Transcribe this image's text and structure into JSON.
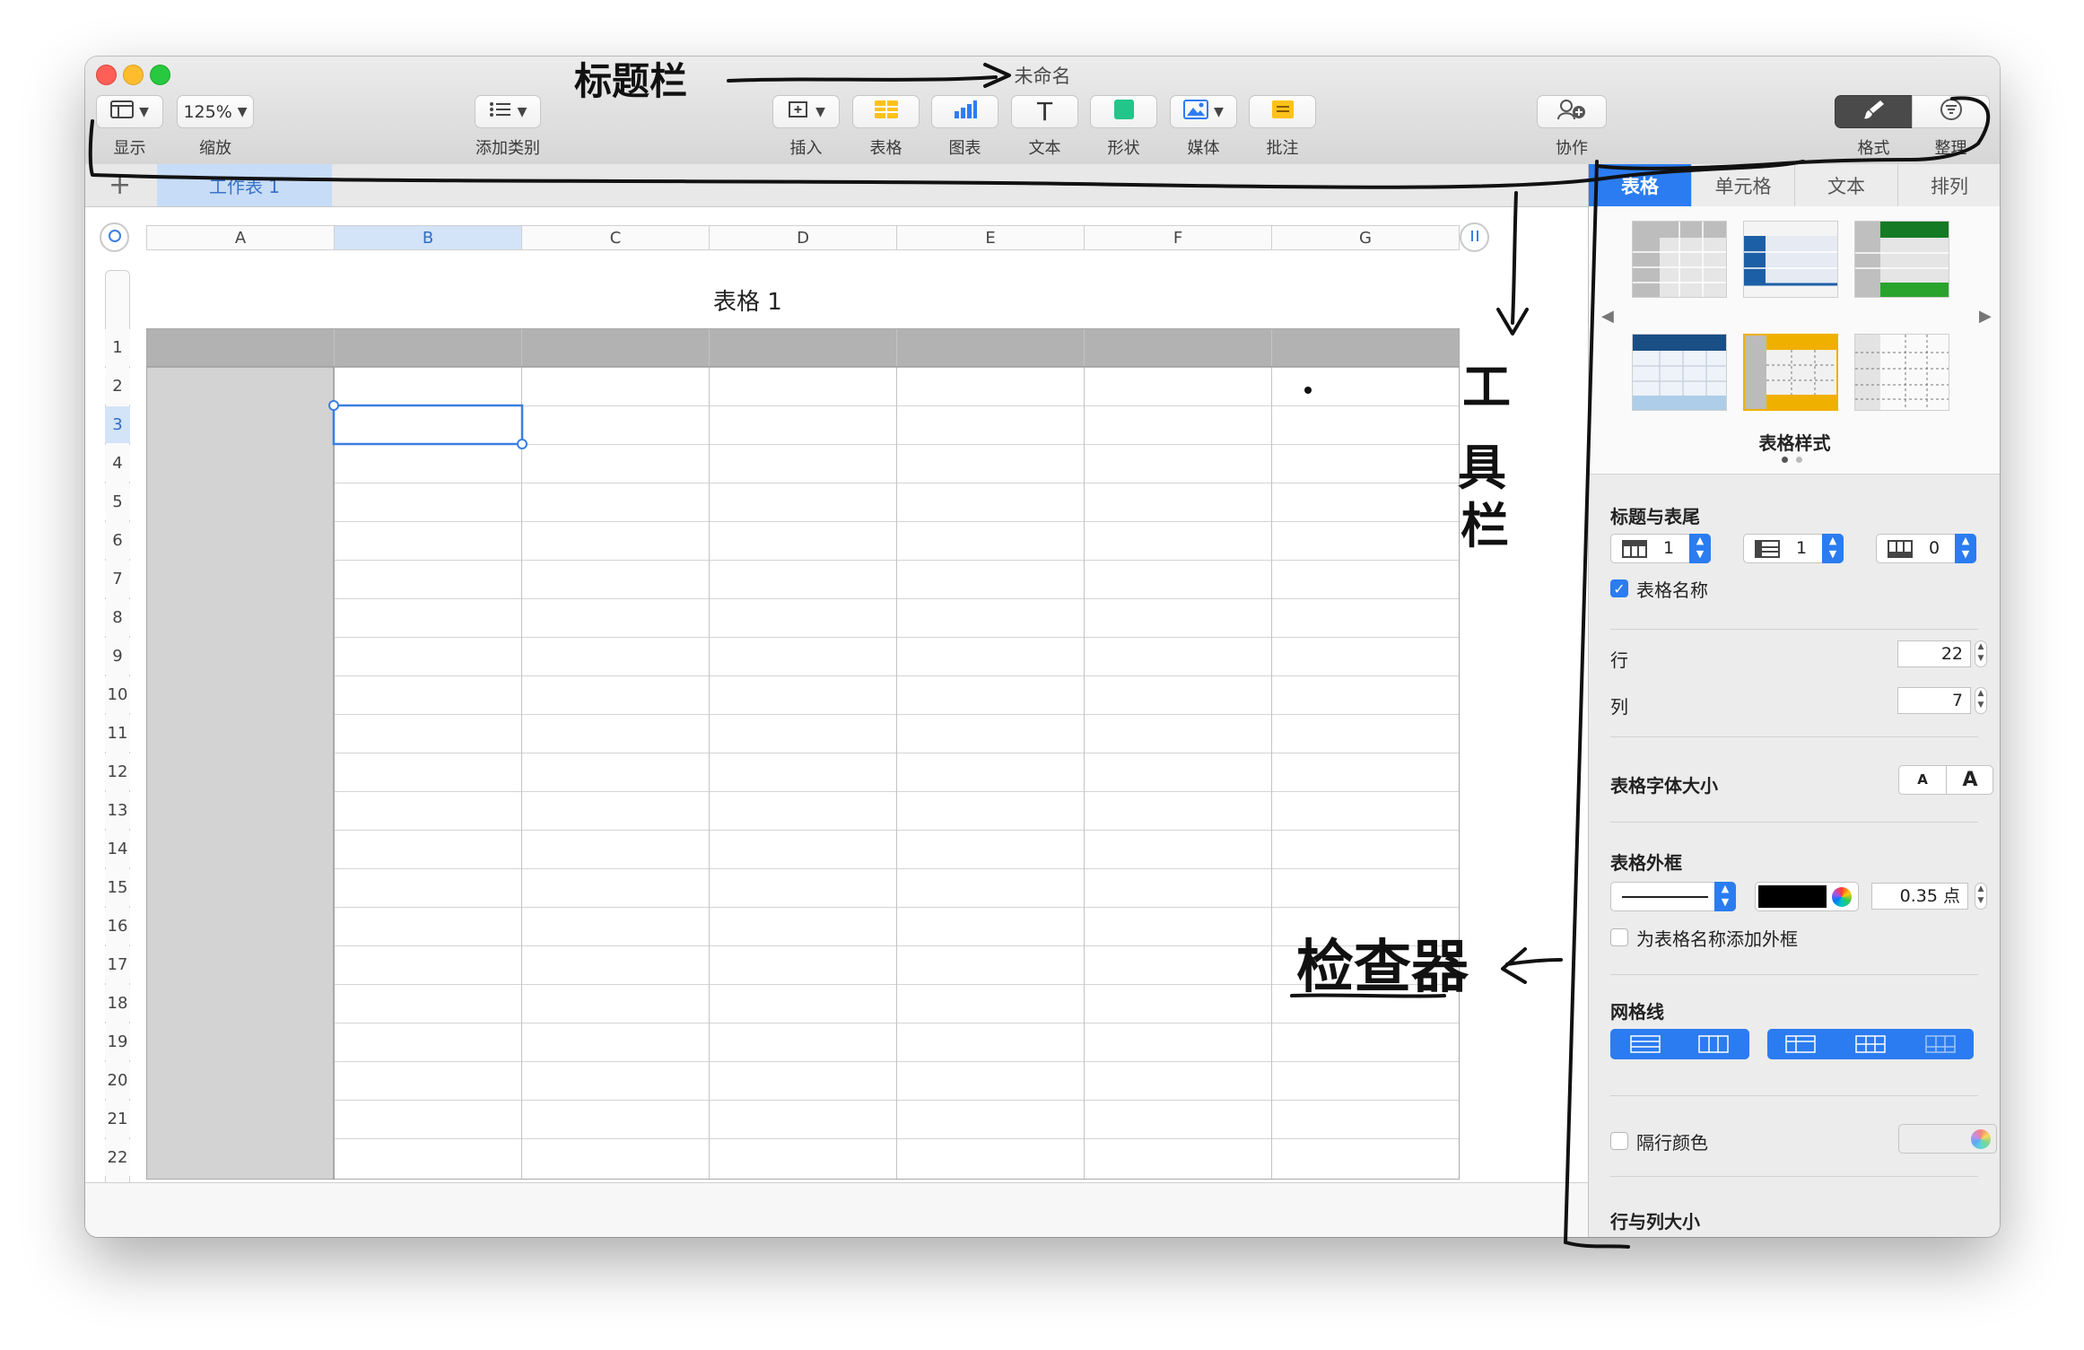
{
  "window": {
    "title": "未命名"
  },
  "toolbar": {
    "view": {
      "label": "显示"
    },
    "zoom": {
      "value": "125%",
      "label": "缩放"
    },
    "add_category": {
      "label": "添加类别"
    },
    "insert": {
      "label": "插入"
    },
    "table": {
      "label": "表格"
    },
    "chart": {
      "label": "图表"
    },
    "text": {
      "label": "文本",
      "glyph": "T"
    },
    "shape": {
      "label": "形状"
    },
    "media": {
      "label": "媒体"
    },
    "comment": {
      "label": "批注"
    },
    "collaborate": {
      "label": "协作"
    },
    "format": {
      "label": "格式"
    },
    "organize": {
      "label": "整理"
    }
  },
  "tabbar": {
    "add_glyph": "+",
    "sheet_tab": "工作表 1"
  },
  "sheet": {
    "table_title": "表格 1",
    "columns": [
      "A",
      "B",
      "C",
      "D",
      "E",
      "F",
      "G"
    ],
    "rows": [
      "1",
      "2",
      "3",
      "4",
      "5",
      "6",
      "7",
      "8",
      "9",
      "10",
      "11",
      "12",
      "13",
      "14",
      "15",
      "16",
      "17",
      "18",
      "19",
      "20",
      "21",
      "22"
    ],
    "selected_column": "B",
    "selected_row": "3"
  },
  "inspector": {
    "tabs": [
      "表格",
      "单元格",
      "文本",
      "排列"
    ],
    "active_tab": "表格",
    "table_styles_label": "表格样式",
    "headers_footer": {
      "title": "标题与表尾",
      "header_rows": "1",
      "header_columns": "1",
      "footer_rows": "0",
      "table_name_checkbox": "表格名称",
      "table_name_checked": true
    },
    "rows_label": "行",
    "rows_value": "22",
    "cols_label": "列",
    "cols_value": "7",
    "font_size": {
      "label": "表格字体大小",
      "small": "A",
      "large": "A"
    },
    "outline": {
      "title": "表格外框",
      "width_value": "0.35 点",
      "color": "#000000",
      "name_outline_checkbox": "为表格名称添加外框"
    },
    "gridlines": {
      "title": "网格线"
    },
    "alternating": {
      "label": "隔行颜色"
    },
    "row_col_size": {
      "title": "行与列大小"
    }
  },
  "annotations": {
    "titlebar_note": "标题栏",
    "toolbar_note": "工具栏",
    "inspector_note": "检查器"
  },
  "colors": {
    "accent_blue": "#2b7cf0",
    "header_gray": "#b2b2b2",
    "header_column_gray": "#d3d3d3",
    "selection_blue": "#3b7fe0"
  }
}
